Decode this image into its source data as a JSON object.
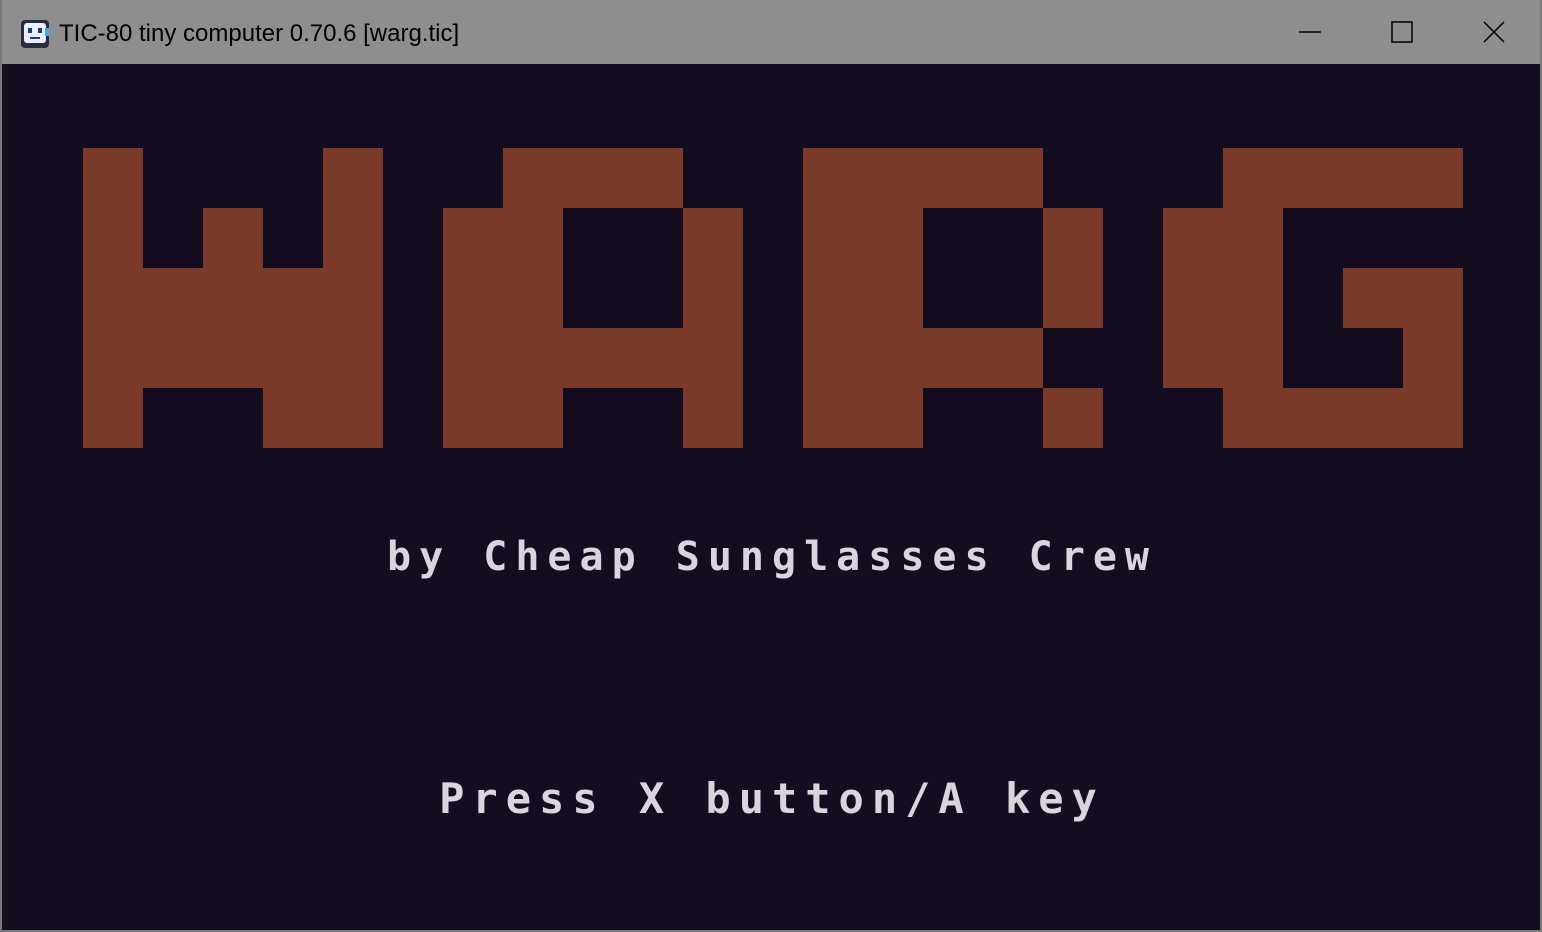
{
  "window": {
    "title": "TIC-80 tiny computer 0.70.6 [warg.tic]",
    "controls": {
      "minimize": "minimize-icon",
      "maximize": "maximize-icon",
      "close": "close-icon"
    }
  },
  "game": {
    "logo_text": "WARG",
    "byline": "by Cheap Sunglasses Crew",
    "prompt": "Press X button/A key"
  },
  "colors": {
    "titlebar": "#8e8e8e",
    "background": "#130d1f",
    "logo": "#7a3a2a",
    "text": "#d8d5dd"
  }
}
